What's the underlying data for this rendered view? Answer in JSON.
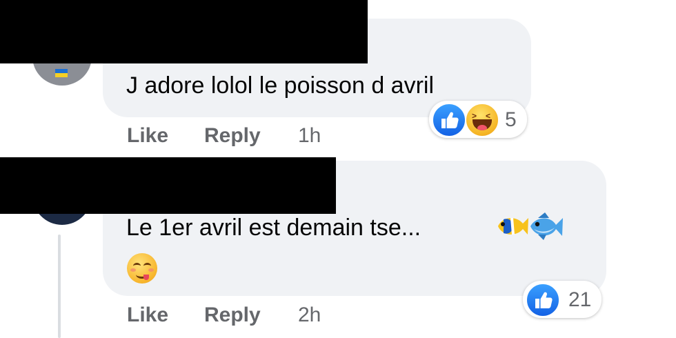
{
  "comments": [
    {
      "text": "J adore lolol le poisson d avril",
      "actions": {
        "like": "Like",
        "reply": "Reply",
        "time": "1h"
      },
      "reactions": {
        "icons": [
          "like-icon",
          "haha-icon"
        ],
        "count": "5"
      }
    },
    {
      "text": "Le 1er avril est demain tse...",
      "emojis": [
        "tropical-fish-emoji",
        "fish-emoji",
        "smiling-face-emoji"
      ],
      "actions": {
        "like": "Like",
        "reply": "Reply",
        "time": "2h"
      },
      "reactions": {
        "icons": [
          "like-icon"
        ],
        "count": "21"
      }
    }
  ],
  "colors": {
    "bubble": "#f0f2f5",
    "secondary_text": "#65676b",
    "like_blue": "#1877f2",
    "redaction": "#000000"
  }
}
